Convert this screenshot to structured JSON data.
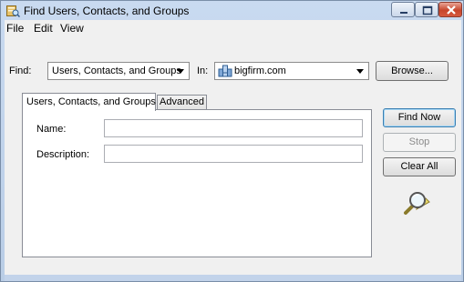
{
  "window": {
    "title": "Find Users, Contacts, and Groups"
  },
  "menu": [
    "File",
    "Edit",
    "View"
  ],
  "find": {
    "label": "Find:",
    "selected": "Users, Contacts, and Groups"
  },
  "in": {
    "label": "In:",
    "selected": "bigfirm.com"
  },
  "buttons": {
    "browse": "Browse...",
    "find_now": "Find Now",
    "stop": "Stop",
    "clear_all": "Clear All"
  },
  "tabs": [
    "Users, Contacts, and Groups",
    "Advanced"
  ],
  "fields": {
    "name_label": "Name:",
    "name_value": "",
    "description_label": "Description:",
    "description_value": ""
  },
  "icons": {
    "app": "directory-search-icon",
    "domain": "domain-icon",
    "search_graphic": "magnifier-icon"
  }
}
